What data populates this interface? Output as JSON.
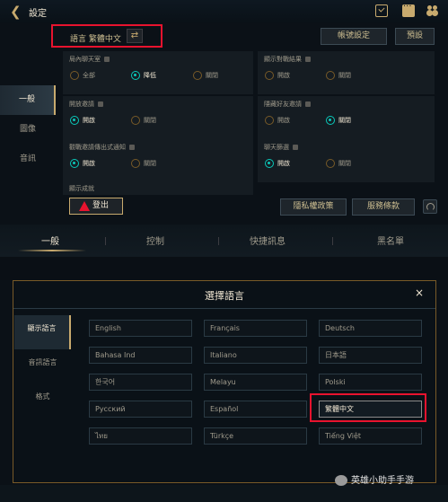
{
  "header": {
    "title": "設定",
    "back_icon": "chevron-left-icon",
    "icons": [
      "mission-check-icon",
      "chat-icon",
      "friends-icon"
    ]
  },
  "language": {
    "label": "語言 繁體中文",
    "swap_icon": "swap-icon"
  },
  "buttons": {
    "account_settings": "帳號設定",
    "defaults": "預設",
    "logout": "登出",
    "privacy": "隱私權政策",
    "terms": "服務條款"
  },
  "sidebar": {
    "items": [
      {
        "label": "一般",
        "active": true
      },
      {
        "label": "圖像",
        "active": false
      },
      {
        "label": "音訊",
        "active": false
      }
    ]
  },
  "settings": {
    "chat": {
      "title": "局內聊天室",
      "options": [
        "全部",
        "降低",
        "關閉"
      ]
    },
    "show_results": {
      "title": "顯示對戰結果",
      "options": [
        "開啟",
        "關閉"
      ]
    },
    "open_invite": {
      "title": "開放邀請",
      "options": [
        "開啟",
        "關閉"
      ]
    },
    "hide_friend_invites": {
      "title": "隱藏好友邀請",
      "options": [
        "開啟",
        "關閉"
      ]
    },
    "spectator_notify": {
      "title": "觀戰邀請傳出式通知",
      "options": [
        "開啟",
        "關閉"
      ]
    },
    "chat_filter": {
      "title": "聊天篩選",
      "options": [
        "開啟",
        "關閉"
      ]
    },
    "show_achievements": {
      "title": "顯示成就"
    }
  },
  "tabs": [
    {
      "label": "一般",
      "active": true
    },
    {
      "label": "控制",
      "active": false
    },
    {
      "label": "快捷訊息",
      "active": false
    },
    {
      "label": "黑名單",
      "active": false
    }
  ],
  "modal": {
    "title": "選擇語言",
    "close": "×",
    "nav": [
      {
        "label": "顯示語言",
        "active": true
      },
      {
        "label": "音訊語言",
        "active": false
      },
      {
        "label": "格式",
        "active": false
      }
    ],
    "languages": [
      "English",
      "Français",
      "Deutsch",
      "Bahasa Ind",
      "Italiano",
      "日本語",
      "한국어",
      "Melayu",
      "Polski",
      "Русский",
      "Español",
      "繁體中文",
      "ไทย",
      "Türkçe",
      "Tiếng Việt"
    ],
    "selected": "繁體中文"
  },
  "watermark": "英雄小助手手游",
  "colors": {
    "gold": "#c8aa6e",
    "teal": "#0ac8b9",
    "highlight_red": "#e8132e",
    "bg": "#0b1117"
  }
}
